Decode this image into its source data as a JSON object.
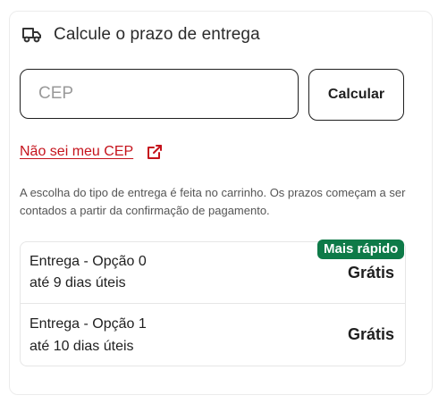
{
  "header": {
    "title": "Calcule o prazo de entrega",
    "icon": "truck-icon"
  },
  "cep": {
    "placeholder": "CEP",
    "value": "",
    "button_label": "Calcular",
    "help_link": "Não sei meu CEP",
    "help_link_icon": "external-link-icon"
  },
  "info_text": "A escolha do tipo de entrega é feita no carrinho. Os prazos começam a ser contados a partir da confirmação de pagamento.",
  "badge": {
    "label": "Mais rápido",
    "color": "#0e7a48"
  },
  "options": [
    {
      "name": "Entrega - Opção 0",
      "time": "até 9 dias úteis",
      "price": "Grátis"
    },
    {
      "name": "Entrega - Opção 1",
      "time": "até 10 dias úteis",
      "price": "Grátis"
    }
  ],
  "colors": {
    "link": "#c5131c",
    "text": "#1f1f1f",
    "muted": "#555555"
  }
}
